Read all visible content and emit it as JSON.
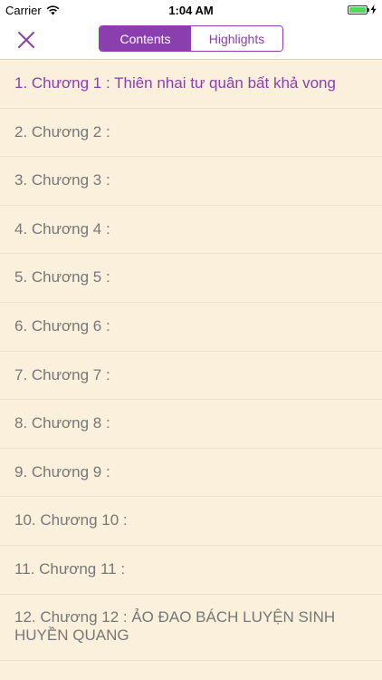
{
  "status_bar": {
    "carrier": "Carrier",
    "time": "1:04 AM",
    "battery_level": 1.0,
    "battery_color": "#4cd964"
  },
  "nav": {
    "close_icon": "close-x-icon",
    "tabs": [
      {
        "label": "Contents",
        "active": true
      },
      {
        "label": "Highlights",
        "active": false
      }
    ],
    "accent_color": "#8b3fae"
  },
  "chapters": [
    {
      "label": "1. Chương 1 :  Thiên nhai tư quân bất khả vong",
      "selected": true
    },
    {
      "label": "2. Chương 2 :",
      "selected": false
    },
    {
      "label": "3. Chương 3 :",
      "selected": false
    },
    {
      "label": "4. Chương 4 :",
      "selected": false
    },
    {
      "label": "5. Chương 5 :",
      "selected": false
    },
    {
      "label": "6. Chương 6 :",
      "selected": false
    },
    {
      "label": "7. Chương 7 :",
      "selected": false
    },
    {
      "label": "8. Chương 8 :",
      "selected": false
    },
    {
      "label": "9. Chương 9 :",
      "selected": false
    },
    {
      "label": "10. Chương 10 :",
      "selected": false
    },
    {
      "label": "11. Chương 11 :",
      "selected": false
    },
    {
      "label": "12. Chương 12 :  ẢO ĐAO BÁCH LUYỆN SINH HUYỀN QUANG",
      "selected": false
    }
  ],
  "colors": {
    "background": "#fbf0dc",
    "text": "#777777",
    "selected_text": "#8b3fae"
  }
}
